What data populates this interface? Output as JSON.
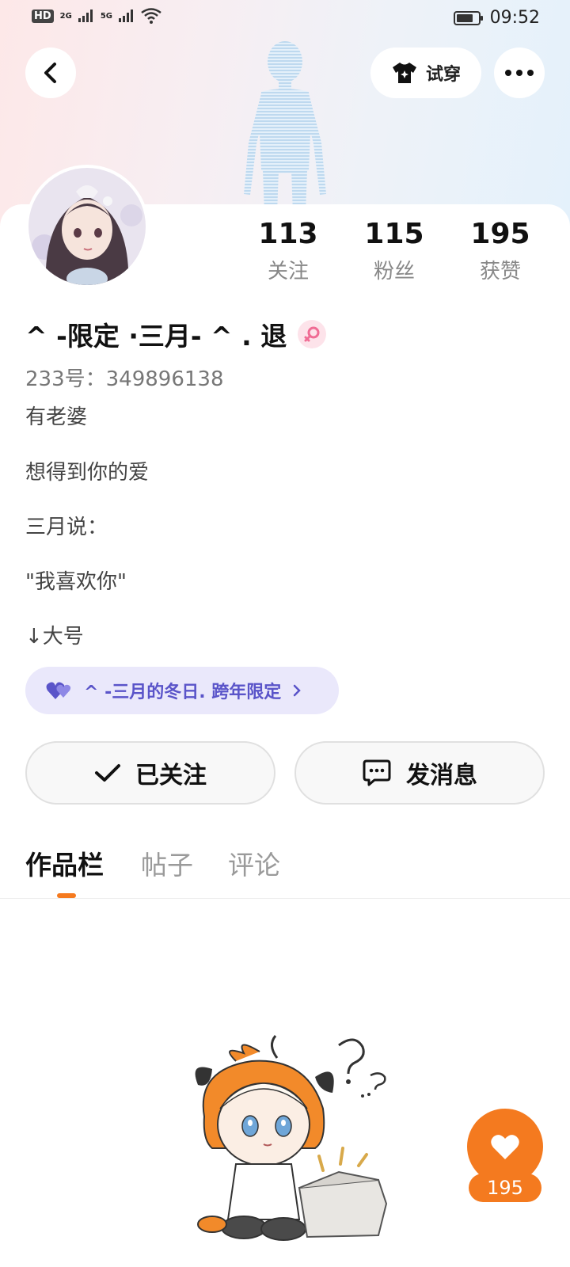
{
  "status_bar": {
    "network_label": "HD",
    "signal_1": "2G",
    "signal_2": "5G",
    "time": "09:52"
  },
  "toolbar": {
    "try_on_label": "试穿"
  },
  "profile": {
    "stats": [
      {
        "value": "113",
        "label": "关注"
      },
      {
        "value": "115",
        "label": "粉丝"
      },
      {
        "value": "195",
        "label": "获赞"
      }
    ],
    "username": "^ -限定 ·三月- ^ . 退",
    "uid": "233号：349896138",
    "bio": [
      "有老婆",
      "想得到你的爱",
      "三月说：",
      "\"我喜欢你\"",
      "↓大号"
    ],
    "linked_account": "^ -三月的冬日. 跨年限定"
  },
  "actions": {
    "follow_label": "已关注",
    "message_label": "发消息"
  },
  "tabs": [
    {
      "label": "作品栏",
      "active": true
    },
    {
      "label": "帖子",
      "active": false
    },
    {
      "label": "评论",
      "active": false
    }
  ],
  "like_fab": {
    "count": "195"
  },
  "colors": {
    "accent": "#f47a1f",
    "chip_bg": "#eae8fb",
    "chip_text": "#5a54c9"
  }
}
